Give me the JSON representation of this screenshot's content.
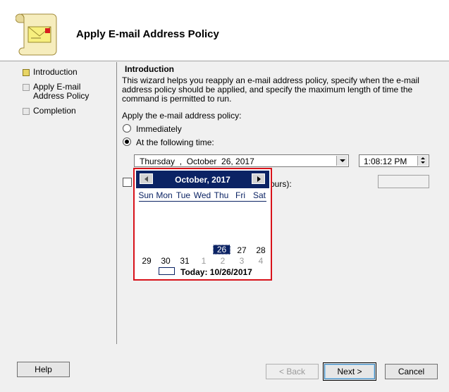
{
  "window": {
    "title": "Apply E-mail Address Policy"
  },
  "sidebar": {
    "items": [
      {
        "label": "Introduction",
        "state": "active"
      },
      {
        "label": "Apply E-mail Address Policy",
        "state": "pending"
      },
      {
        "label": "Completion",
        "state": "pending"
      }
    ]
  },
  "main": {
    "section_title": "Introduction",
    "description": "This wizard helps you reapply an e-mail address policy, specify when the e-mail address policy should be applied, and specify the maximum length of time the command is permitted to run.",
    "apply_label": "Apply the e-mail address policy:",
    "radio_immediately": "Immediately",
    "radio_following_time": "At the following time:",
    "selected_radio": "At the following time:",
    "date_value": "Thursday  ,  October  26, 2017",
    "time_value": "1:08:12 PM",
    "duration_label_partial": "ours):",
    "duration_value": ""
  },
  "calendar": {
    "month_year": "October, 2017",
    "days_of_week": [
      "Sun",
      "Mon",
      "Tue",
      "Wed",
      "Thu",
      "Fri",
      "Sat"
    ],
    "row1": [
      {
        "day": "26",
        "muted": false,
        "selected": true
      },
      {
        "day": "27",
        "muted": false
      },
      {
        "day": "28",
        "muted": false
      }
    ],
    "row2": [
      {
        "day": "29",
        "muted": false
      },
      {
        "day": "30",
        "muted": false
      },
      {
        "day": "31",
        "muted": false
      },
      {
        "day": "1",
        "muted": true
      },
      {
        "day": "2",
        "muted": true
      },
      {
        "day": "3",
        "muted": true
      },
      {
        "day": "4",
        "muted": true
      }
    ],
    "today_label": "Today: 10/26/2017"
  },
  "footer": {
    "help_label": "Help",
    "back_label": "< Back",
    "next_label": "Next >",
    "cancel_label": "Cancel"
  },
  "colors": {
    "calendar_header": "#0b2364",
    "highlight_border": "#d8121a",
    "active_step": "#e8d565"
  },
  "icons": {
    "wizard": "scroll-envelope-icon",
    "prev": "triangle-left-icon",
    "next": "triangle-right-icon",
    "dropdown": "chevron-down-icon"
  }
}
